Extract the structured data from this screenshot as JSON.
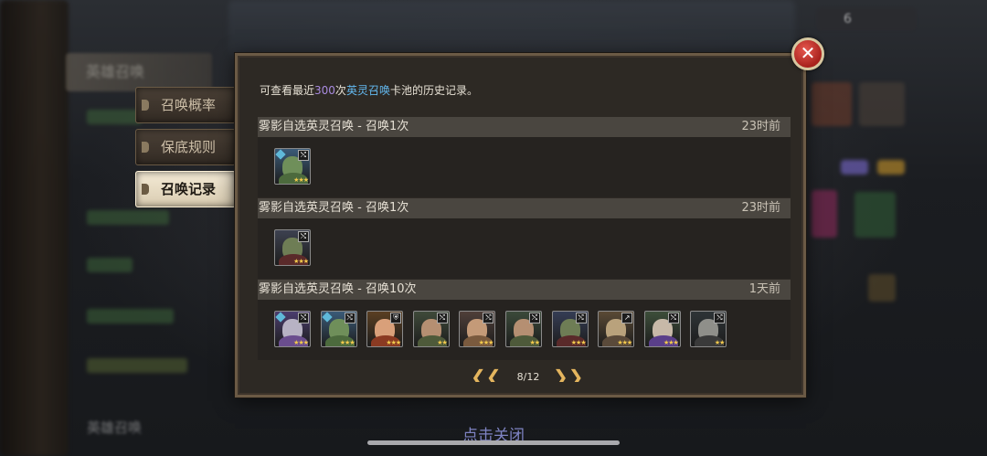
{
  "background": {
    "left_tab": "英雄召唤",
    "bottom_label": "英雄召唤",
    "bottom_close": "点击关闭",
    "topright_text": "6"
  },
  "side_tabs": [
    {
      "label": "召唤概率",
      "active": false
    },
    {
      "label": "保底规则",
      "active": false
    },
    {
      "label": "召唤记录",
      "active": true
    }
  ],
  "intro": {
    "prefix": "可查看最近",
    "count": "300",
    "middle": "次",
    "pool": "英灵召唤",
    "suffix": "卡池的历史记录。"
  },
  "records": [
    {
      "title": "雾影自选英灵召唤 - 召唤1次",
      "time": "23时前",
      "heroes": [
        {
          "icon": "lizard-archer-icon",
          "stars": "★★★",
          "cls": "⤭",
          "gem": true,
          "face": "#6f8f5a",
          "bodyc": "#4c6a3d",
          "bg": "#3b5b78"
        }
      ]
    },
    {
      "title": "雾影自选英灵召唤 - 召唤1次",
      "time": "23时前",
      "heroes": [
        {
          "icon": "goblin-archer-icon",
          "stars": "★★★",
          "cls": "⤭",
          "gem": false,
          "face": "#6e7d55",
          "bodyc": "#5a2a2a",
          "bg": "#3d4150"
        }
      ]
    },
    {
      "title": "雾影自选英灵召唤 - 召唤10次",
      "time": "1天前",
      "heroes": [
        {
          "icon": "dragon-mage-icon",
          "stars": "★★★",
          "cls": "⤭",
          "gem": true,
          "face": "#b7b2c4",
          "bodyc": "#6a4d8e",
          "bg": "#4b3d6e"
        },
        {
          "icon": "lizard-archer-icon",
          "stars": "★★★",
          "cls": "⤭",
          "gem": true,
          "face": "#6f8f5a",
          "bodyc": "#4c6a3d",
          "bg": "#3b5b78"
        },
        {
          "icon": "redhead-warrior-icon",
          "stars": "★★★",
          "cls": "⛨",
          "gem": false,
          "face": "#d9a07a",
          "bodyc": "#8a3a22",
          "bg": "#5a3f22"
        },
        {
          "icon": "helmet-soldier-icon",
          "stars": "★★",
          "cls": "⤭",
          "gem": false,
          "face": "#b58f72",
          "bodyc": "#4e5a3a",
          "bg": "#3f4a3a"
        },
        {
          "icon": "barbarian-icon",
          "stars": "★★★",
          "cls": "⤭",
          "gem": false,
          "face": "#c49a78",
          "bodyc": "#7a5a3e",
          "bg": "#4f3f39"
        },
        {
          "icon": "helmet-soldier-icon",
          "stars": "★★",
          "cls": "⤭",
          "gem": false,
          "face": "#b58f72",
          "bodyc": "#4e5a3a",
          "bg": "#3b4a3a"
        },
        {
          "icon": "goblin-archer-icon",
          "stars": "★★★",
          "cls": "⤭",
          "gem": false,
          "face": "#6e7d55",
          "bodyc": "#5a2a2a",
          "bg": "#353d55"
        },
        {
          "icon": "orc-brute-icon",
          "stars": "★★★",
          "cls": "↗",
          "gem": false,
          "face": "#b9a27c",
          "bodyc": "#5a4a3a",
          "bg": "#5a4a35"
        },
        {
          "icon": "armored-knight-icon",
          "stars": "★★★",
          "cls": "⤭",
          "gem": false,
          "face": "#c7b9a8",
          "bodyc": "#5a3f8a",
          "bg": "#3d4e3a"
        },
        {
          "icon": "horned-undead-icon",
          "stars": "★★",
          "cls": "⤭",
          "gem": false,
          "face": "#8f8f8a",
          "bodyc": "#3a3a3a",
          "bg": "#2e3437"
        }
      ]
    }
  ],
  "pager": {
    "prev": "❮❮",
    "label": "8/12",
    "next": "❯❯"
  },
  "close": "✕"
}
